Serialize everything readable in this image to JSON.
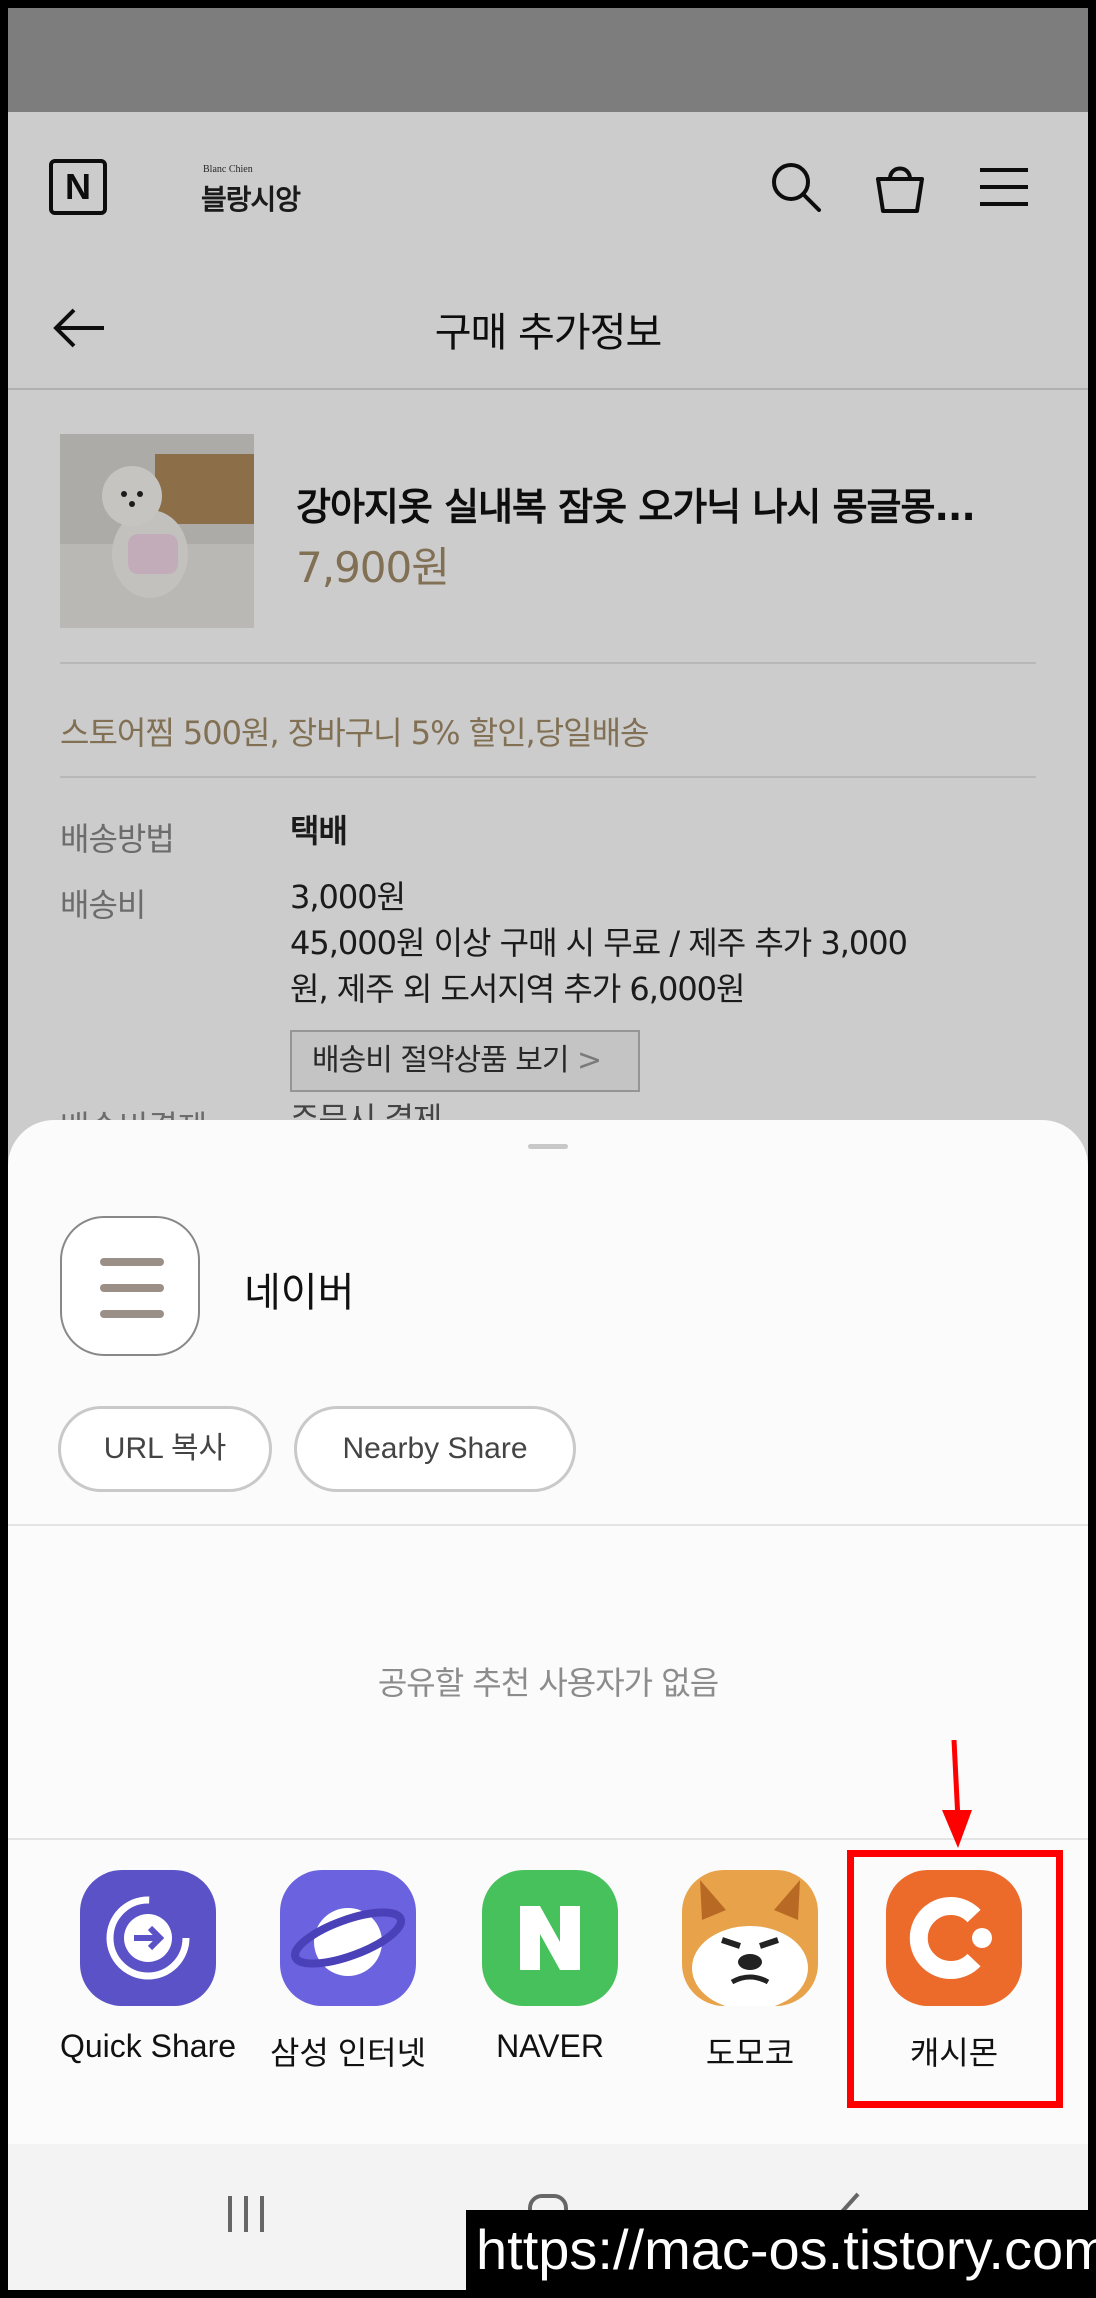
{
  "header": {
    "brand_small": "Blanc Chien",
    "brand_name": "블랑시앙",
    "logo_letter": "N"
  },
  "subheader": {
    "title": "구매 추가정보"
  },
  "product": {
    "name": "강아지옷 실내복 잠옷 오가닉 나시 몽글몽...",
    "price": "7,900원"
  },
  "benefit": "스토어찜 500원, 장바구니 5% 할인,당일배송",
  "shipping": {
    "method_label": "배송방법",
    "method_value": "택배",
    "fee_label": "배송비",
    "fee_value": "3,000원",
    "fee_note_line1": "45,000원 이상 구매 시 무료 / 제주 추가 3,000",
    "fee_note_line2": "원, 제주 외 도서지역 추가 6,000원",
    "save_button": "배송비 절약상품 보기",
    "partial_label": "배송비결제",
    "partial_value": "주문시 결제"
  },
  "share_sheet": {
    "app_name": "네이버",
    "chips": [
      "URL 복사",
      "Nearby Share"
    ],
    "no_recommendations": "공유할 추천 사용자가 없음",
    "targets": [
      {
        "label": "Quick Share",
        "icon": "quick-share-icon",
        "color": "#5b52c8"
      },
      {
        "label": "삼성 인터넷",
        "icon": "samsung-internet-icon",
        "color": "#6b62e0"
      },
      {
        "label": "NAVER",
        "icon": "naver-icon",
        "color": "#47c15c"
      },
      {
        "label": "도모코",
        "icon": "domoko-icon",
        "color": "#e8a24a"
      },
      {
        "label": "캐시몬",
        "icon": "cashmon-icon",
        "color": "#ec6a2a"
      }
    ],
    "highlight_color": "#ff0000"
  },
  "watermark": "https://mac-os.tistory.com"
}
